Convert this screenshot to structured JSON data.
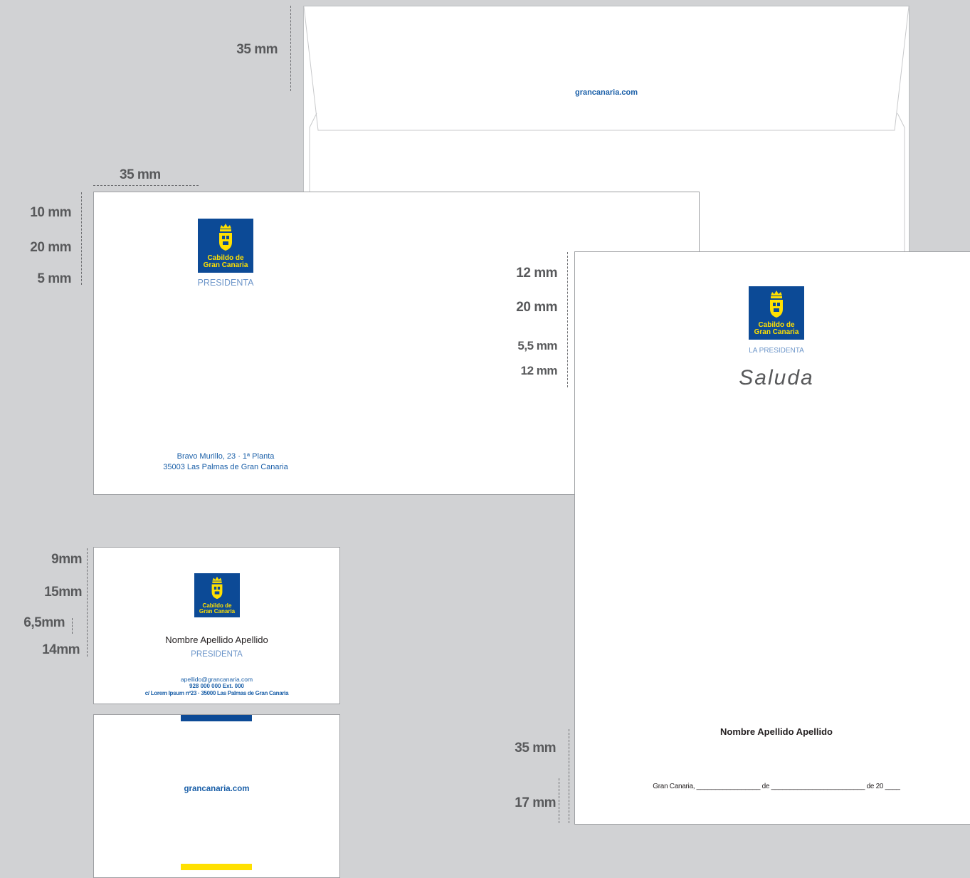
{
  "envelope_back": {
    "flap_height": "35 mm",
    "web": "grancanaria.com"
  },
  "envelope_front": {
    "left_margin": "35 mm",
    "dims": [
      "10 mm",
      "20 mm",
      "5 mm"
    ],
    "logo_text": [
      "Cabildo de",
      "Gran Canaria"
    ],
    "role": "PRESIDENTA",
    "address_line1": "Bravo Murillo, 23 · 1ª Planta",
    "address_line2": "35003 Las Palmas de Gran Canaria"
  },
  "saluda": {
    "dims_top": [
      "12 mm",
      "20 mm",
      "5,5 mm",
      "12 mm"
    ],
    "logo_text": [
      "Cabildo de",
      "Gran Canaria"
    ],
    "role": "LA PRESIDENTA",
    "title": "Saluda",
    "name": "Nombre Apellido Apellido",
    "date_line": "Gran Canaria, _________________ de _________________________ de 20 ____",
    "dims_bottom": [
      "35 mm",
      "17 mm"
    ]
  },
  "business_card": {
    "dims": [
      "9mm",
      "15mm",
      "6,5mm",
      "14mm"
    ],
    "logo_text": [
      "Cabildo de",
      "Gran Canaria"
    ],
    "name": "Nombre Apellido Apellido",
    "role": "PRESIDENTA",
    "email": "apellido@grancanaria.com",
    "phone": "928 000 000  Ext. 000",
    "address": "c/ Lorem Ipsum nº23 · 35000 Las Palmas de Gran Canaria"
  },
  "business_card_back": {
    "web": "grancanaria.com",
    "bar_colors": [
      "#0c4a96",
      "#ffe000"
    ]
  }
}
